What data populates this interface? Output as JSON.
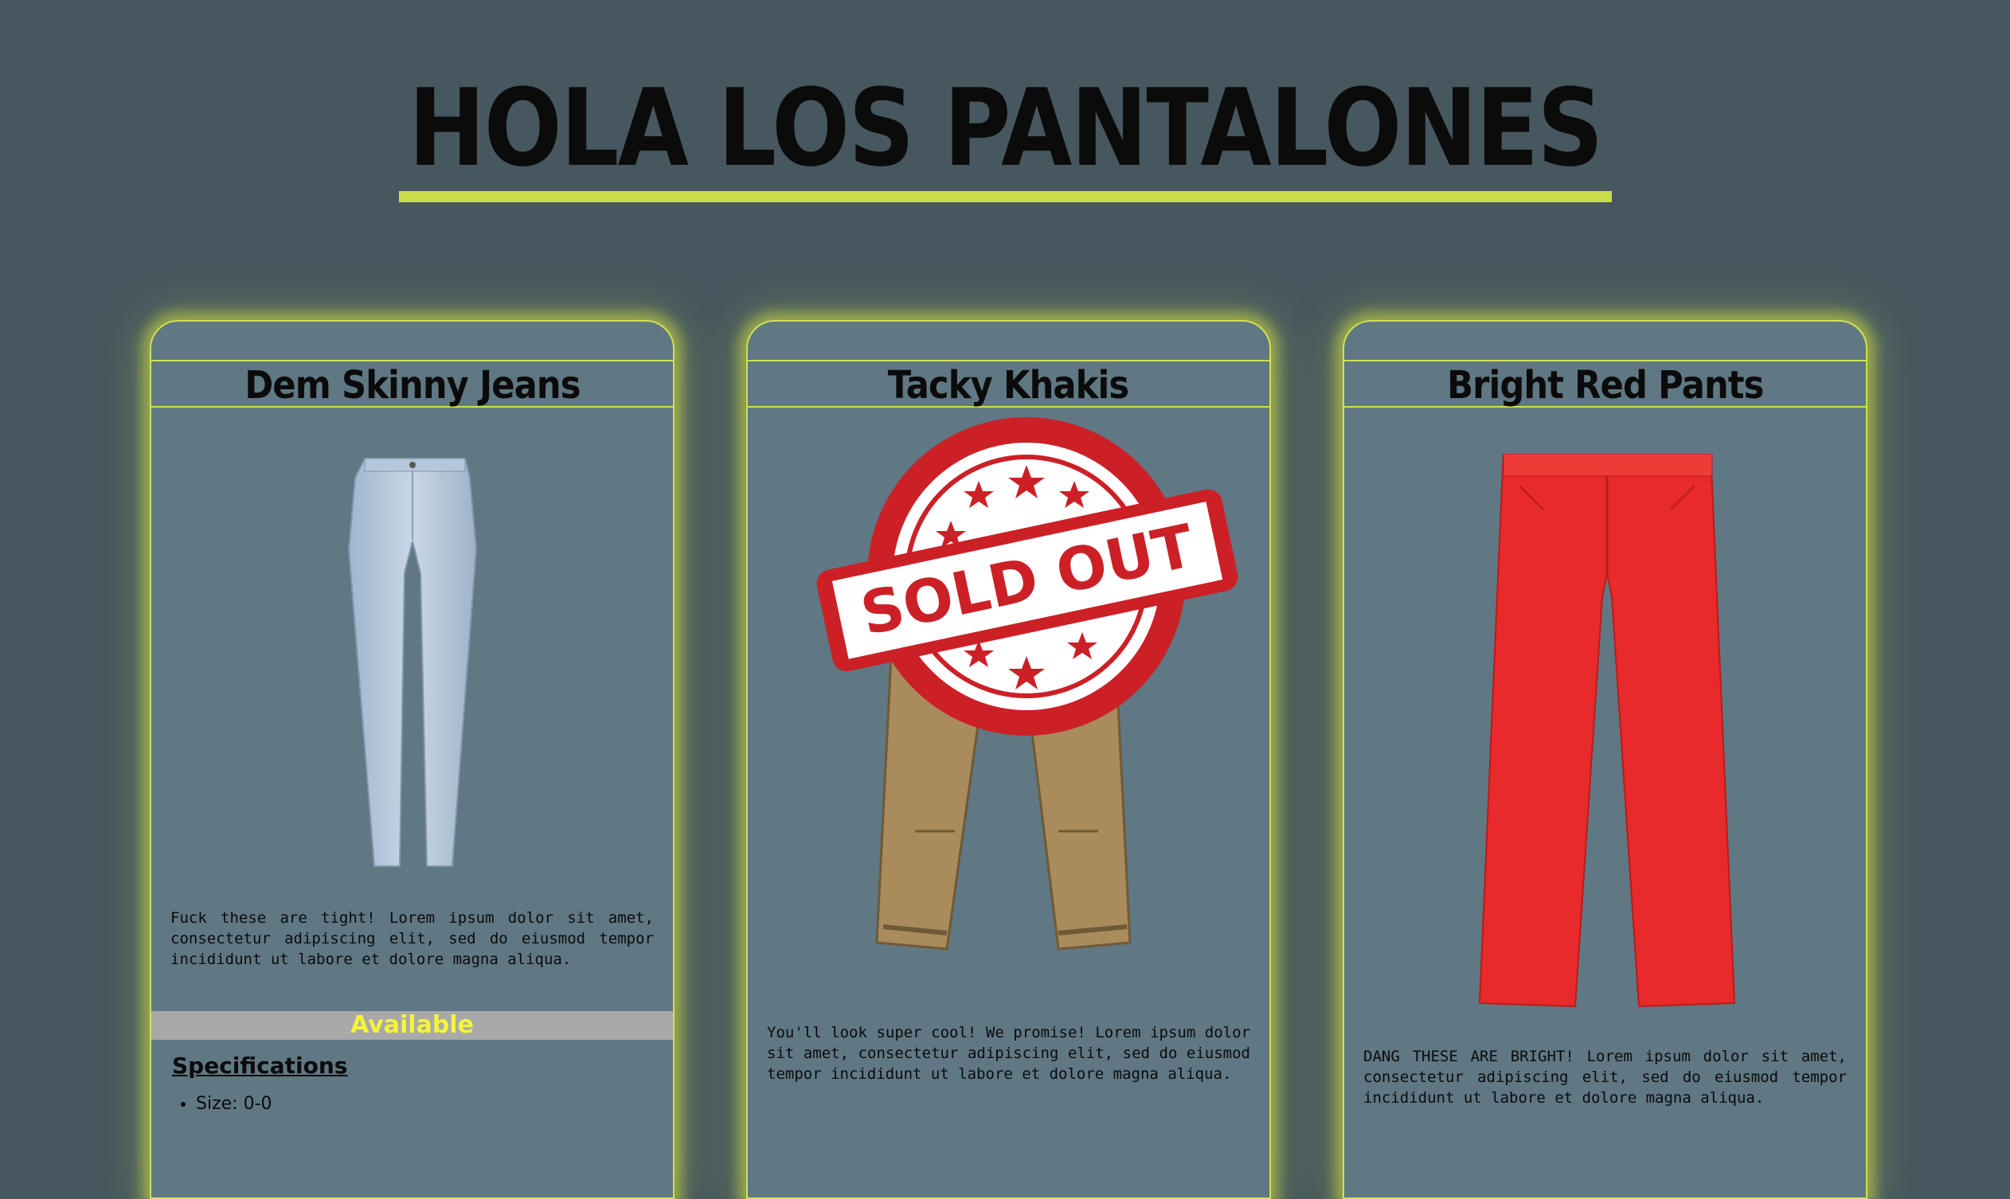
{
  "header": {
    "title": "HOLA LOS PANTALONES"
  },
  "colors": {
    "background": "#46575f",
    "card": "#5f7883",
    "accent": "#cfe04f",
    "status_text": "#f4f43a",
    "status_bg": "#a9a9a9"
  },
  "products": [
    {
      "name": "Dem Skinny Jeans",
      "image": "light-blue-skinny-jeans",
      "description": "Fuck these are tight! Lorem ipsum dolor sit amet, consectetur adipiscing elit, sed do eiusmod tempor incididunt ut labore et dolore magna aliqua.",
      "status": "Available",
      "specs_heading": "Specifications",
      "specs": [
        "Size: 0-0"
      ]
    },
    {
      "name": "Tacky Khakis",
      "image": "khaki-cargo-pants",
      "badge": "SOLD OUT",
      "description": "You'll look super cool! We promise! Lorem ipsum dolor sit amet, consectetur adipiscing elit, sed do eiusmod tempor incididunt ut labore et dolore magna aliqua."
    },
    {
      "name": "Bright Red Pants",
      "image": "red-flared-pants",
      "description": "DANG THESE ARE BRIGHT! Lorem ipsum dolor sit amet, consectetur adipiscing elit, sed do eiusmod tempor incididunt ut labore et dolore magna aliqua."
    }
  ]
}
